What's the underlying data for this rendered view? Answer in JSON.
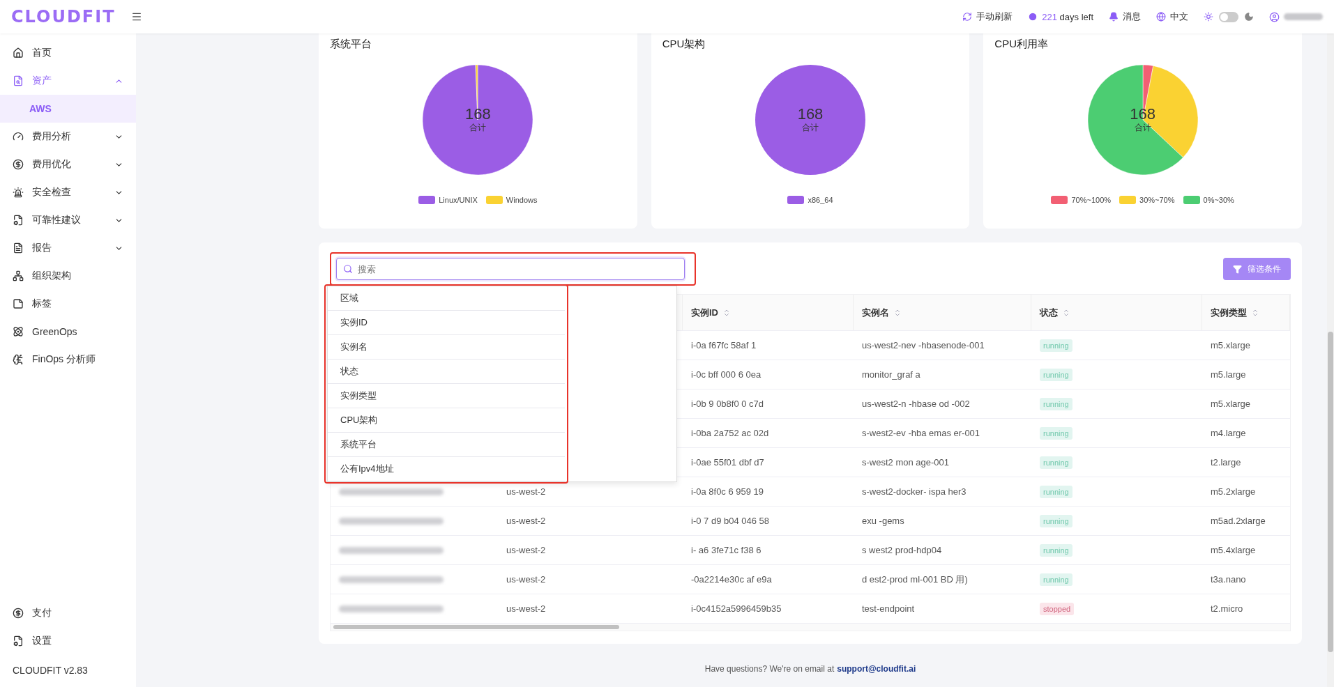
{
  "brand": "CLOUDFIT",
  "topbar": {
    "refresh": "手动刷新",
    "days": "221",
    "days_suffix": "days left",
    "messages": "消息",
    "language": "中文",
    "dark_mode": false
  },
  "sidebar": {
    "items": [
      {
        "label": "首页",
        "kind": "link",
        "selected": false
      },
      {
        "label": "资产",
        "kind": "group",
        "expanded": true,
        "selected": true,
        "children": [
          {
            "label": "AWS",
            "selected": true
          }
        ]
      },
      {
        "label": "费用分析",
        "kind": "group",
        "expanded": false,
        "selected": false
      },
      {
        "label": "费用优化",
        "kind": "group",
        "expanded": false,
        "selected": false
      },
      {
        "label": "安全检查",
        "kind": "group",
        "expanded": false,
        "selected": false
      },
      {
        "label": "可靠性建议",
        "kind": "group",
        "expanded": false,
        "selected": false
      },
      {
        "label": "报告",
        "kind": "group",
        "expanded": false,
        "selected": false
      },
      {
        "label": "组织架构",
        "kind": "link",
        "selected": false
      },
      {
        "label": "标签",
        "kind": "link",
        "selected": false
      },
      {
        "label": "GreenOps",
        "kind": "link",
        "selected": false
      },
      {
        "label": "FinOps 分析师",
        "kind": "link",
        "selected": false
      }
    ],
    "bottom": [
      {
        "label": "支付"
      },
      {
        "label": "设置"
      }
    ],
    "version": "CLOUDFIT v2.83"
  },
  "charts": [
    {
      "total": "168",
      "total_label": "合计",
      "chart_data": {
        "type": "pie",
        "title": "系统平台",
        "categories": [
          "Linux/UNIX",
          "Windows"
        ],
        "colors": [
          "#9b5de5",
          "#fad232"
        ],
        "series": [
          {
            "values": [
              99.4,
              0.6
            ]
          }
        ]
      }
    },
    {
      "total": "168",
      "total_label": "合计",
      "chart_data": {
        "type": "pie",
        "title": "CPU架构",
        "categories": [
          "x86_64"
        ],
        "colors": [
          "#9b5de5"
        ],
        "series": [
          {
            "values": [
              100
            ]
          }
        ]
      }
    },
    {
      "total": "168",
      "total_label": "合计",
      "chart_data": {
        "type": "pie",
        "title": "CPU利用率",
        "categories": [
          "70%~100%",
          "30%~70%",
          "0%~30%"
        ],
        "colors": [
          "#f25f73",
          "#fad232",
          "#4ccd72"
        ],
        "series": [
          {
            "values": [
              3,
              34,
              63
            ]
          }
        ]
      }
    }
  ],
  "search": {
    "placeholder": "搜索"
  },
  "filter_button": "筛选条件",
  "field_dropdown": [
    "区域",
    "实例ID",
    "实例名",
    "状态",
    "实例类型",
    "CPU架构",
    "系统平台",
    "公有Ipv4地址"
  ],
  "table": {
    "columns": [
      "实例ID",
      "实例名",
      "状态",
      "实例类型"
    ],
    "rows": [
      {
        "instance_id": "i-0a f67fc 58af 1",
        "instance_name": "us-west2-nev -hbasenode-001",
        "status": "running",
        "stopped": false,
        "instance_type": "m5.xlarge"
      },
      {
        "instance_id": "i-0c bff 000 6 0ea",
        "instance_name": "monitor_graf a",
        "status": "running",
        "stopped": false,
        "instance_type": "m5.large"
      },
      {
        "instance_id": "i-0b 9 0b8f0 0 c7d",
        "instance_name": "us-west2-n -hbase od -002",
        "status": "running",
        "stopped": false,
        "instance_type": "m5.xlarge"
      },
      {
        "instance_id": "i-0ba 2a752 ac 02d",
        "instance_name": "s-west2-ev -hba emas er-001",
        "status": "running",
        "stopped": false,
        "instance_type": "m4.large"
      },
      {
        "instance_id": "i-0ae 55f01 dbf d7",
        "instance_name": "s-west2 mon age-001",
        "status": "running",
        "stopped": false,
        "instance_type": "t2.large"
      },
      {
        "region": "us-west-2",
        "instance_id": "i-0a 8f0c 6 959 19",
        "instance_name": "s-west2-docker- ispa her3",
        "status": "running",
        "stopped": false,
        "instance_type": "m5.2xlarge"
      },
      {
        "region": "us-west-2",
        "instance_id": "i-0 7 d9 b04 046 58",
        "instance_name": "exu -gems",
        "status": "running",
        "stopped": false,
        "instance_type": "m5ad.2xlarge"
      },
      {
        "region": "us-west-2",
        "instance_id": "i- a6 3fe71c f38 6",
        "instance_name": "s west2 prod-hdp04",
        "status": "running",
        "stopped": false,
        "instance_type": "m5.4xlarge"
      },
      {
        "region": "us-west-2",
        "instance_id": "-0a2214e30c af e9a",
        "instance_name": "d est2-prod ml-001 BD 用)",
        "status": "running",
        "stopped": false,
        "instance_type": "t3a.nano"
      },
      {
        "region": "us-west-2",
        "instance_id": "i-0c4152a5996459b35",
        "instance_name": "test-endpoint",
        "status": "stopped",
        "stopped": true,
        "instance_type": "t2.micro"
      }
    ]
  },
  "footer": {
    "text": "Have questions? We're on email at",
    "email": "support@cloudfit.ai"
  }
}
